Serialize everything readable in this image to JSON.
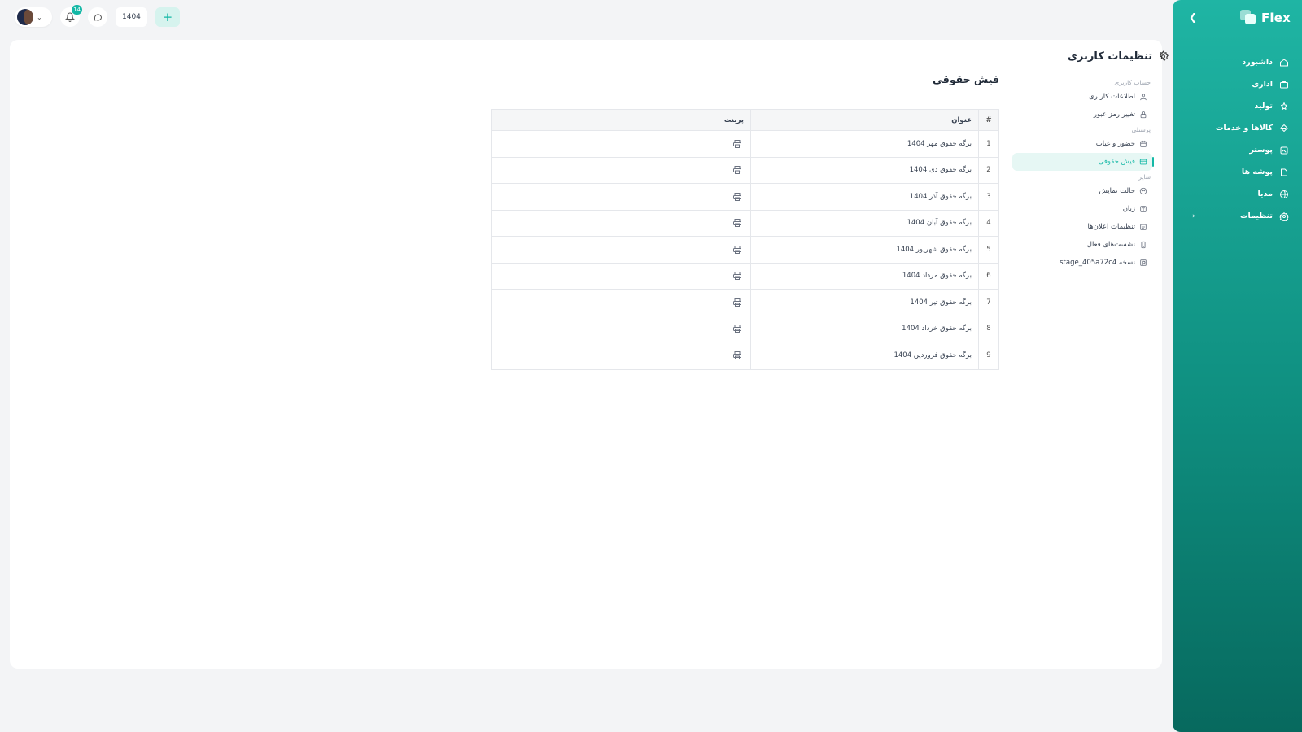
{
  "brand": {
    "name": "Flex"
  },
  "nav": [
    {
      "label": "داشبورد",
      "icon": "home-icon"
    },
    {
      "label": "اداری",
      "icon": "briefcase-icon"
    },
    {
      "label": "تولید",
      "icon": "factory-icon"
    },
    {
      "label": "کالاها و خدمات",
      "icon": "boxes-icon"
    },
    {
      "label": "پوستر",
      "icon": "poster-icon"
    },
    {
      "label": "پوشه ها",
      "icon": "folder-icon"
    },
    {
      "label": "مدیا",
      "icon": "media-icon"
    },
    {
      "label": "تنظیمات",
      "icon": "gear-icon",
      "has_submenu": true
    }
  ],
  "topbar": {
    "notifications_count": "14",
    "year": "1404"
  },
  "settings": {
    "title": "تنظیمات کاربری",
    "groups": [
      {
        "label": "حساب کاربری",
        "items": [
          {
            "label": "اطلاعات کاربری",
            "icon": "user-icon"
          },
          {
            "label": "تغییر رمز عبور",
            "icon": "lock-icon"
          }
        ]
      },
      {
        "label": "پرسنلی",
        "items": [
          {
            "label": "حضور و غیاب",
            "icon": "calendar-icon"
          },
          {
            "label": "فیش حقوقی",
            "icon": "receipt-icon",
            "active": true
          }
        ]
      },
      {
        "label": "سایر",
        "items": [
          {
            "label": "حالت نمایش",
            "icon": "palette-icon"
          },
          {
            "label": "زبان",
            "icon": "language-icon"
          },
          {
            "label": "تنظیمات اعلان‌ها",
            "icon": "bell-settings-icon"
          },
          {
            "label": "نشست‌های فعال",
            "icon": "device-icon"
          },
          {
            "label": "نسخه stage_405a72c4",
            "icon": "version-icon"
          }
        ]
      }
    ]
  },
  "payslips": {
    "title": "فیش حقوقی",
    "columns": {
      "num": "#",
      "title": "عنوان",
      "print": "پرینت"
    },
    "rows": [
      {
        "num": "1",
        "title": "برگه حقوق مهر 1404"
      },
      {
        "num": "2",
        "title": "برگه حقوق دی 1404"
      },
      {
        "num": "3",
        "title": "برگه حقوق آذر 1404"
      },
      {
        "num": "4",
        "title": "برگه حقوق آبان 1404"
      },
      {
        "num": "5",
        "title": "برگه حقوق شهریور 1404"
      },
      {
        "num": "6",
        "title": "برگه حقوق مرداد 1404"
      },
      {
        "num": "7",
        "title": "برگه حقوق تیر 1404"
      },
      {
        "num": "8",
        "title": "برگه حقوق خرداد 1404"
      },
      {
        "num": "9",
        "title": "برگه حقوق فروردین 1404"
      }
    ]
  },
  "colors": {
    "accent": "#14b8a6",
    "sidebar_top": "#1fb5a4",
    "sidebar_bottom": "#07695e"
  }
}
